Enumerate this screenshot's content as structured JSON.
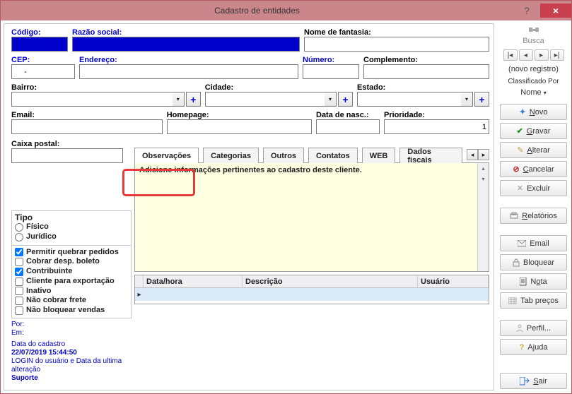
{
  "window": {
    "title": "Cadastro de entidades"
  },
  "titlebar": {
    "help": "?",
    "close": "×"
  },
  "labels": {
    "codigo": "Código:",
    "razao": "Razão social:",
    "fantasia": "Nome de fantasia:",
    "cep": "CEP:",
    "endereco": "Endereço:",
    "numero": "Número:",
    "complemento": "Complemento:",
    "bairro": "Bairro:",
    "cidade": "Cidade:",
    "estado": "Estado:",
    "email": "Email:",
    "homepage": "Homepage:",
    "datanasc": "Data de nasc.:",
    "prioridade": "Prioridade:",
    "caixa": "Caixa postal:"
  },
  "values": {
    "cep": "     -",
    "prioridade": "1"
  },
  "tabs": {
    "items": [
      "Observações",
      "Categorias",
      "Outros",
      "Contatos",
      "WEB",
      "Dados fiscais"
    ],
    "scroll_left": "◂",
    "scroll_right": "▸"
  },
  "memo": {
    "placeholder": "Adicione informações pertinentes ao cadastro deste cliente."
  },
  "grid": {
    "cols": [
      "Data/hora",
      "Descrição",
      "Usuário"
    ]
  },
  "tipo": {
    "title": "Tipo",
    "fisico": "Físico",
    "juridico": "Jurídico"
  },
  "checks": {
    "quebrar": "Permitir quebrar pedidos",
    "boleto": "Cobrar desp. boleto",
    "contrib": "Contribuinte",
    "export": "Cliente para exportação",
    "inativo": "Inativo",
    "frete": "Não cobrar frete",
    "bloq": "Não bloquear vendas"
  },
  "meta": {
    "por": "Por:",
    "em": "Em:",
    "data_lbl": "Data do cadastro",
    "data_val": "22/07/2019 15:44:50",
    "login": "LOGIN do usuário e Data da ultima alteração",
    "suporte": "Suporte"
  },
  "side": {
    "busca": "Busca",
    "nav_first": "|◂",
    "nav_prev": "◂",
    "nav_next": "▸",
    "nav_last": "▸|",
    "novo_reg": "(novo registro)",
    "class": "Classificado Por",
    "class_val": "Nome",
    "novo": "Novo",
    "gravar": "Gravar",
    "alterar": "Alterar",
    "cancelar": "Cancelar",
    "excluir": "Excluir",
    "relatorios": "Relatórios",
    "email": "Email",
    "bloquear": "Bloquear",
    "nota": "Nota",
    "tabprecos": "Tab preços",
    "perfil": "Perfil...",
    "ajuda": "Ajuda",
    "sair": "Sair"
  }
}
